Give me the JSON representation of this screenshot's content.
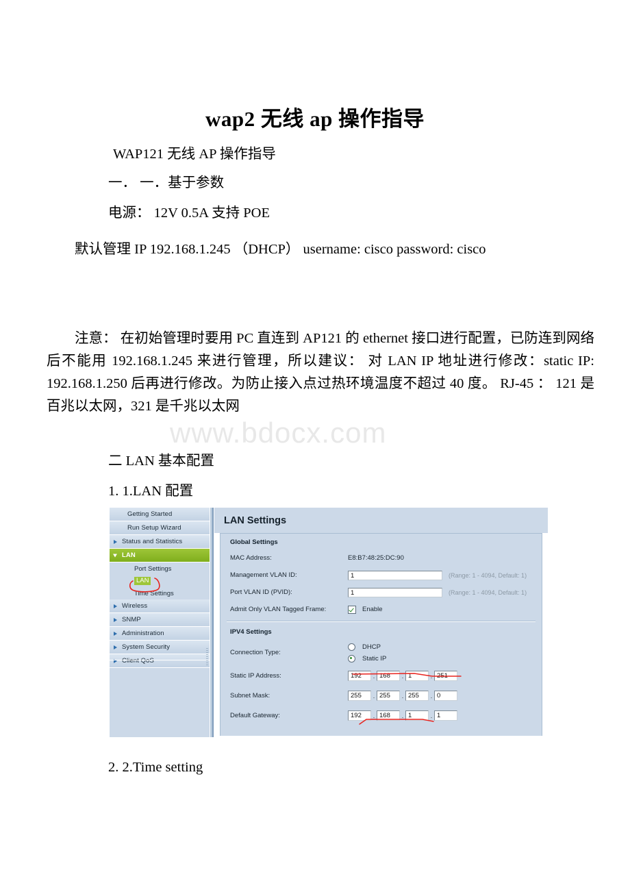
{
  "document": {
    "title": "wap2 无线 ap 操作指导",
    "subtitle": "WAP121 无线 AP 操作指导",
    "heading_1": "一． 一．基于参数",
    "power_line": "电源： 12V 0.5A 支持 POE",
    "default_ip_line": "默认管理 IP 192.168.1.245 （DHCP） username: cisco password: cisco",
    "note_paragraph": "注意： 在初始管理时要用 PC 直连到 AP121 的 ethernet 接口进行配置，已防连到网络后不能用 192.168.1.245 来进行管理，所以建议： 对 LAN IP 地址进行修改：static IP: 192.168.1.250 后再进行修改。为防止接入点过热环境温度不超过 40 度。 RJ-45 ： 121 是百兆以太网，321 是千兆以太网",
    "heading_2": "二 LAN 基本配置",
    "heading_2_1": "1. 1.LAN 配置",
    "heading_2_2": "2. 2.Time setting",
    "watermark": "www.bdocx.com"
  },
  "screenshot": {
    "nav": {
      "items": [
        {
          "label": "Getting Started",
          "type": "plain"
        },
        {
          "label": "Run Setup Wizard",
          "type": "plain"
        },
        {
          "label": "Status and Statistics",
          "type": "collapsed"
        },
        {
          "label": "LAN",
          "type": "expanded-active"
        },
        {
          "label": "Wireless",
          "type": "collapsed"
        },
        {
          "label": "SNMP",
          "type": "collapsed"
        },
        {
          "label": "Administration",
          "type": "collapsed"
        },
        {
          "label": "System Security",
          "type": "collapsed"
        },
        {
          "label": "Client QoS",
          "type": "collapsed"
        }
      ],
      "sub_items": [
        {
          "label": "Port Settings",
          "selected": false
        },
        {
          "label": "LAN",
          "selected": true
        },
        {
          "label": "Time Settings",
          "selected": false
        }
      ]
    },
    "panel": {
      "title": "LAN Settings",
      "global_settings": {
        "section_label": "Global Settings",
        "mac_label": "MAC Address:",
        "mac_value": "E8:B7:48:25:DC:90",
        "mgmt_vlan_label": "Management VLAN ID:",
        "mgmt_vlan_value": "1",
        "mgmt_vlan_hint": "(Range: 1 - 4094, Default: 1)",
        "pvid_label": "Port VLAN ID (PVID):",
        "pvid_value": "1",
        "pvid_hint": "(Range: 1 - 4094, Default: 1)",
        "tagged_label": "Admit Only VLAN Tagged Frame:",
        "tagged_checkbox_label": "Enable",
        "tagged_checked": true
      },
      "ipv4_settings": {
        "section_label": "IPV4 Settings",
        "connection_type_label": "Connection Type:",
        "option_dhcp": "DHCP",
        "option_static": "Static IP",
        "selected_connection_type": "Static IP",
        "static_ip_label": "Static IP Address:",
        "static_ip_octets": [
          "192",
          "168",
          "1",
          "251"
        ],
        "subnet_label": "Subnet Mask:",
        "subnet_octets": [
          "255",
          "255",
          "255",
          "0"
        ],
        "gateway_label": "Default Gateway:",
        "gateway_octets": [
          "192",
          "168",
          "1",
          "1"
        ]
      }
    },
    "annotation_color": "#e8241f"
  }
}
